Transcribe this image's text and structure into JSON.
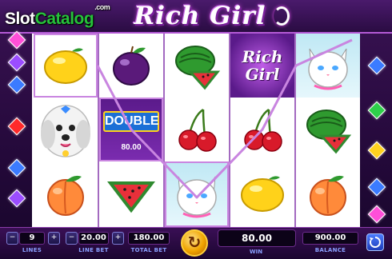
{
  "brand_watermark": {
    "prefix": "Slot",
    "accent": "Catalog",
    "suffix": ".com"
  },
  "game": {
    "title": "Rich Girl"
  },
  "reels": [
    {
      "symbols": [
        "lemon",
        "dog",
        "peach"
      ]
    },
    {
      "symbols": [
        "plum",
        "double",
        "watermelon"
      ]
    },
    {
      "symbols": [
        "watermelon",
        "cherries",
        "cat"
      ]
    },
    {
      "symbols": [
        "rich-girl-logo",
        "cherries",
        "lemon"
      ]
    },
    {
      "symbols": [
        "cat",
        "watermelon",
        "peach"
      ]
    }
  ],
  "double_symbol": {
    "label": "DOUBLE",
    "value": "80.00"
  },
  "wild_logo": {
    "line1": "Rich",
    "line2": "Girl"
  },
  "controls": {
    "lines": {
      "value": "9",
      "label": "LINES"
    },
    "line_bet": {
      "value": "20.00",
      "label": "LINE BET"
    },
    "total_bet": {
      "value": "180.00",
      "label": "TOTAL BET"
    },
    "win": {
      "value": "80.00",
      "label": "WIN"
    },
    "balance": {
      "value": "900.00",
      "label": "BALANCE"
    },
    "minus_glyph": "−",
    "plus_glyph": "+",
    "spin_glyph": "↻"
  },
  "colors": {
    "payline": "#c985e0",
    "gem_colors": [
      "#ff4fd8",
      "#3b7bff",
      "#ff2a2a",
      "#2ed04a",
      "#ffd21f",
      "#9b4dff"
    ]
  }
}
